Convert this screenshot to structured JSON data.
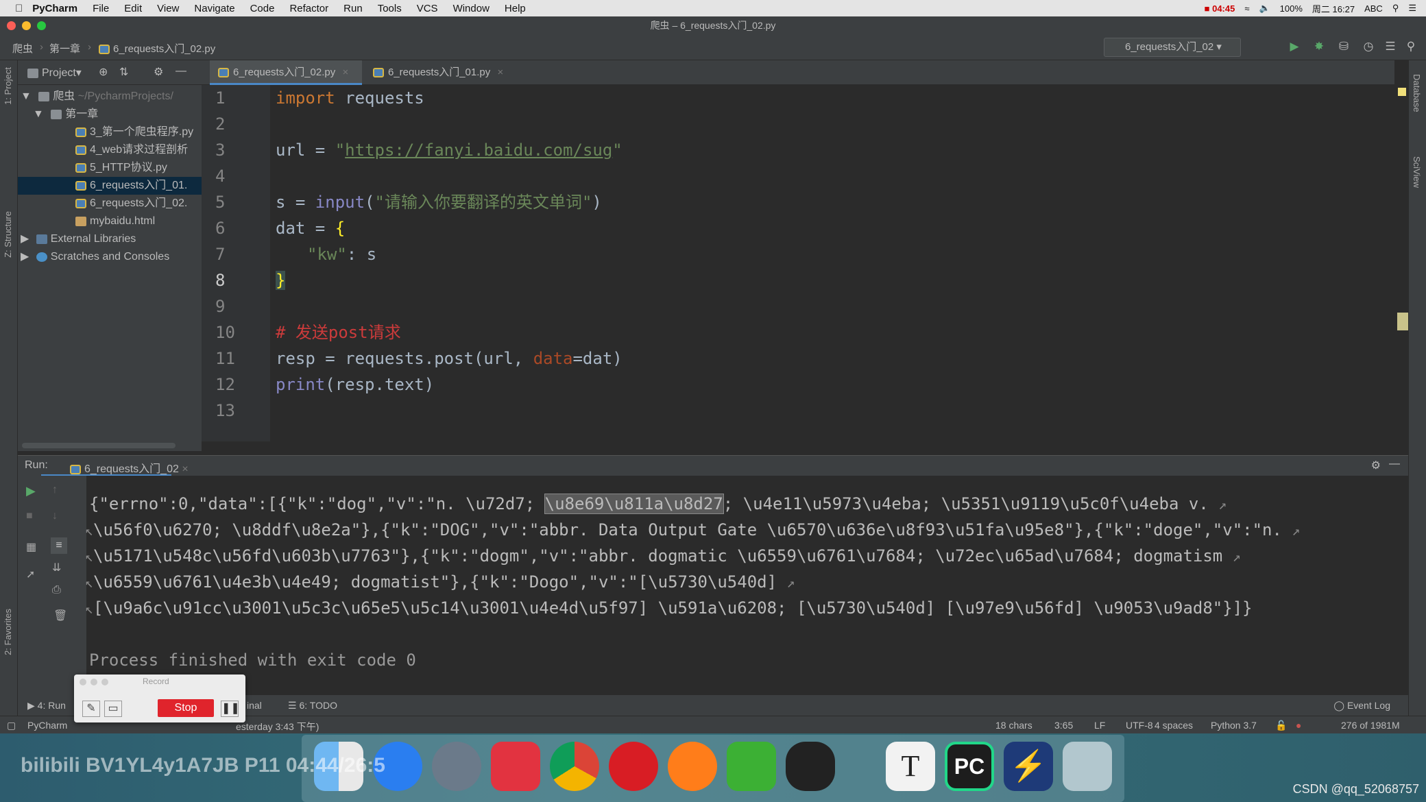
{
  "menubar": {
    "app": "PyCharm",
    "items": [
      "File",
      "Edit",
      "View",
      "Navigate",
      "Code",
      "Refactor",
      "Run",
      "Tools",
      "VCS",
      "Window",
      "Help"
    ],
    "record_time": "04:45",
    "battery": "100%",
    "clock": "周二 16:27",
    "input_method": "ABC"
  },
  "window": {
    "title": "爬虫 – 6_requests入门_02.py"
  },
  "breadcrumb": [
    "爬虫",
    "第一章",
    "6_requests入门_02.py"
  ],
  "run_config": "6_requests入门_02",
  "project": {
    "label": "Project",
    "root": "爬虫",
    "root_path": "~/PycharmProjects/",
    "chapter": "第一章",
    "files": [
      "3_第一个爬虫程序.py",
      "4_web请求过程剖析",
      "5_HTTP协议.py",
      "6_requests入门_01.",
      "6_requests入门_02.",
      "mybaidu.html"
    ],
    "external": "External Libraries",
    "scratches": "Scratches and Consoles"
  },
  "tabs": [
    "6_requests入门_02.py",
    "6_requests入门_01.py"
  ],
  "side_labels": {
    "project": "1: Project",
    "structure": "Z: Structure",
    "favorites": "2: Favorites",
    "database": "Database",
    "sciview": "SciView"
  },
  "code": {
    "line_numbers": [
      "1",
      "2",
      "3",
      "4",
      "5",
      "6",
      "7",
      "8",
      "9",
      "10",
      "11",
      "12",
      "13"
    ],
    "l1_kw": "import",
    "l1_rest": " requests",
    "l3_a": "url = ",
    "l3_q1": "\"",
    "l3_url": "https://fanyi.baidu.com/sug",
    "l3_q2": "\"",
    "l5_a": "s = ",
    "l5_fn": "input",
    "l5_p1": "(",
    "l5_str": "\"请输入你要翻译的英文单词\"",
    "l5_p2": ")",
    "l6_a": "dat = ",
    "l6_brace": "{",
    "l7_key": "\"kw\"",
    "l7_rest": ": s",
    "l8_brace": "}",
    "l10_comment": "# 发送post请求",
    "l11_a": "resp = requests.post(url, ",
    "l11_param": "data",
    "l11_b": "=dat)",
    "l12_fn": "print",
    "l12_rest": "(resp.text)"
  },
  "run": {
    "label": "Run:",
    "tab": "6_requests入门_02",
    "lines": {
      "l1_a": "{\"errno\":0,\"data\":[{\"k\":\"dog\",\"v\":\"n. \\u72d7; ",
      "l1_sel": "\\u8e69\\u811a\\u8d27",
      "l1_b": "; \\u4e11\\u5973\\u4eba; \\u5351\\u9119\\u5c0f\\u4eba v.",
      "l2": "\\u56f0\\u6270; \\u8ddf\\u8e2a\"},{\"k\":\"DOG\",\"v\":\"abbr. Data Output Gate \\u6570\\u636e\\u8f93\\u51fa\\u95e8\"},{\"k\":\"doge\",\"v\":\"n.",
      "l3": "\\u5171\\u548c\\u56fd\\u603b\\u7763\"},{\"k\":\"dogm\",\"v\":\"abbr. dogmatic \\u6559\\u6761\\u7684; \\u72ec\\u65ad\\u7684; dogmatism",
      "l4": "\\u6559\\u6761\\u4e3b\\u4e49; dogmatist\"},{\"k\":\"Dogo\",\"v\":\"[\\u5730\\u540d]",
      "l5": "[\\u9a6c\\u91cc\\u3001\\u5c3c\\u65e5\\u5c14\\u3001\\u4e4d\\u5f97] \\u591a\\u6208; [\\u5730\\u540d] [\\u97e9\\u56fd] \\u9053\\u9ad8\"}]}"
    },
    "finished": "Process finished with exit code 0"
  },
  "record": {
    "title": "Record",
    "stop": "Stop"
  },
  "bottom_tools": {
    "run": "4: Run",
    "terminal": "inal",
    "todo": "6: TODO",
    "event_log": "Event Log"
  },
  "status": {
    "left": "PyCharm",
    "left_msg": "esterday 3:43 下午)",
    "chars": "18 chars",
    "pos": "3:65",
    "lf": "LF",
    "enc": "UTF-8",
    "indent": "4 spaces",
    "python": "Python 3.7",
    "memory": "276 of 1981M"
  },
  "watermark": "CSDN @qq_52068757",
  "bilibili": "bilibili  BV1YL4y1A7JB P11 04:44/26:5"
}
